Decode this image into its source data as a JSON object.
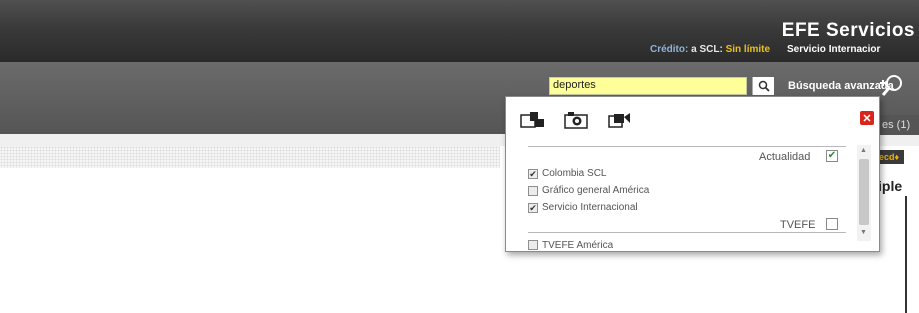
{
  "header": {
    "brand": "EFE Servicios",
    "credit_label": "Crédito:",
    "credit_account": "a SCL:",
    "credit_limit": "Sin límite",
    "service": "Servicio Internacior"
  },
  "search": {
    "value": "deportes",
    "advanced_label": "Búsqueda avanzada"
  },
  "right": {
    "tab": "es (1)",
    "badge": "ecd♦",
    "word": "iple"
  },
  "dropdown": {
    "sections": [
      {
        "title": "Actualidad",
        "checked": true,
        "items": [
          {
            "label": "Colombia SCL",
            "checked": true
          },
          {
            "label": "Gráfico general América",
            "checked": false
          },
          {
            "label": "Servicio Internacional",
            "checked": true
          }
        ]
      },
      {
        "title": "TVEFE",
        "checked": false,
        "items": [
          {
            "label": "TVEFE América",
            "checked": false
          }
        ]
      }
    ],
    "media_icons": [
      "text-photo-icon",
      "camera-icon",
      "video-camera-icon"
    ]
  },
  "colors": {
    "accent": "#e8c21b",
    "close": "#d9261c",
    "input_bg": "#ffff99"
  }
}
